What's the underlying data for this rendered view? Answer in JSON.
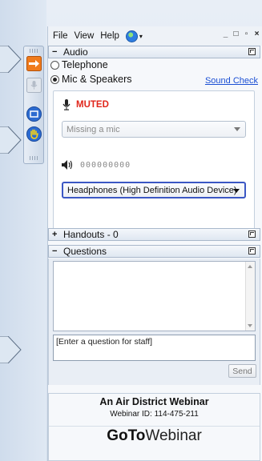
{
  "menubar": {
    "file": "File",
    "view": "View",
    "help": "Help",
    "caret": "▾",
    "window_buttons": [
      "_",
      "□",
      "▫",
      "×"
    ]
  },
  "audio": {
    "header": "Audio",
    "options": {
      "telephone": "Telephone",
      "mic_speakers": "Mic & Speakers",
      "selected": "mic_speakers"
    },
    "sound_check": "Sound Check",
    "status": "MUTED",
    "mic_device": "Missing a mic",
    "speaker_level": "000000000",
    "speaker_device": "Headphones (High Definition Audio Device)"
  },
  "handouts": {
    "header": "Handouts - 0",
    "toggle": "+"
  },
  "questions": {
    "header": "Questions",
    "toggle": "−",
    "input_placeholder": "[Enter a question for staff]",
    "send_label": "Send"
  },
  "footer": {
    "title": "An Air District Webinar",
    "webinar_id": "Webinar ID: 114-475-211",
    "brand_bold": "GoTo",
    "brand_light": "Webinar"
  },
  "colors": {
    "muted": "#e0261b",
    "link": "#1a4fd4",
    "accent": "#3b57c4",
    "raise_hand": "#2c6bd0"
  }
}
